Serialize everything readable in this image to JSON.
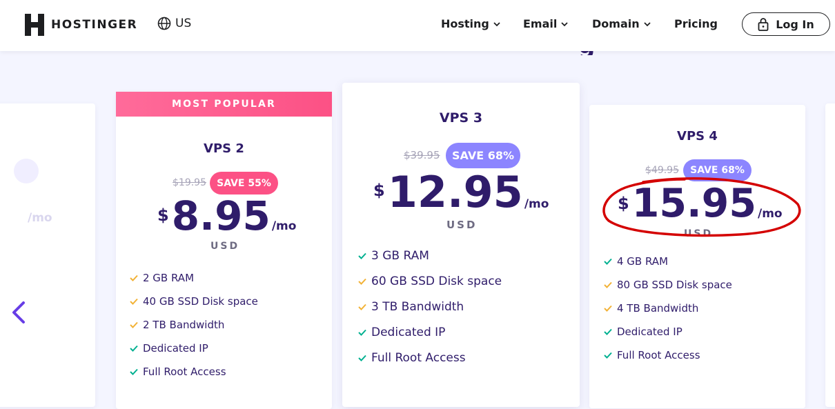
{
  "header": {
    "brand": "HOSTINGER",
    "locale": "US",
    "nav": [
      "Hosting",
      "Email",
      "Domain",
      "Pricing"
    ],
    "login": "Log In"
  },
  "ghost_card": {
    "per": "/mo"
  },
  "plans": [
    {
      "badge": "MOST POPULAR",
      "name": "VPS 2",
      "old_price": "$19.95",
      "save": "SAVE 55%",
      "currency": "$",
      "price": "8.95",
      "per": "/mo",
      "currency_code": "USD",
      "features": [
        "2 GB RAM",
        "40 GB SSD Disk space",
        "2 TB Bandwidth",
        "Dedicated IP",
        "Full Root Access"
      ]
    },
    {
      "name": "VPS 3",
      "old_price": "$39.95",
      "save": "SAVE 68%",
      "currency": "$",
      "price": "12.95",
      "per": "/mo",
      "currency_code": "USD",
      "features": [
        "3 GB RAM",
        "60 GB SSD Disk space",
        "3 TB Bandwidth",
        "Dedicated IP",
        "Full Root Access"
      ]
    },
    {
      "name": "VPS 4",
      "old_price": "$49.95",
      "save": "SAVE 68%",
      "currency": "$",
      "price": "15.95",
      "per": "/mo",
      "currency_code": "USD",
      "features": [
        "4 GB RAM",
        "80 GB SSD Disk space",
        "4 TB Bandwidth",
        "Dedicated IP",
        "Full Root Access"
      ]
    }
  ],
  "colors": {
    "primary": "#2f1c6a",
    "accent_pink": "#fc5185",
    "accent_purple": "#8c85ff",
    "check_orange": "#f2b236",
    "check_green": "#00b090",
    "annotation_red": "#d40000"
  }
}
